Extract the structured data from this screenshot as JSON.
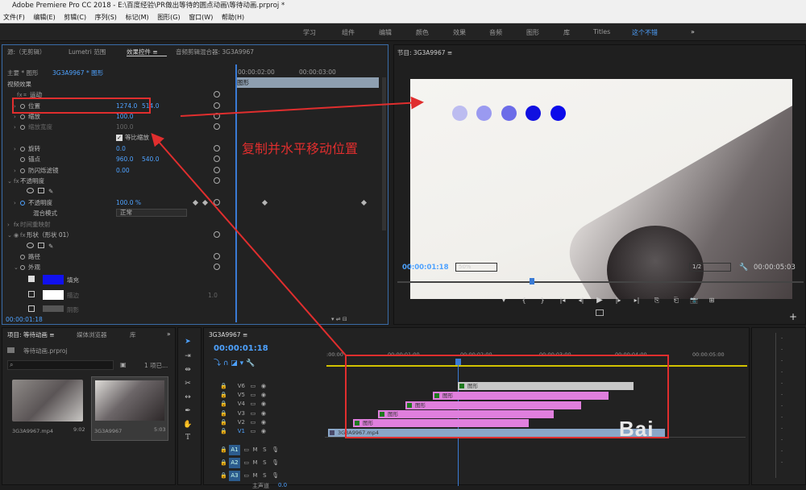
{
  "app": {
    "title": "Adobe Premiere Pro CC 2018 - E:\\百度经验\\PR做出等待的圆点动画\\等待动画.prproj *",
    "logo": "Pr"
  },
  "menu": [
    "文件(F)",
    "编辑(E)",
    "剪辑(C)",
    "序列(S)",
    "标记(M)",
    "图形(G)",
    "窗口(W)",
    "帮助(H)"
  ],
  "workspaces": [
    "学习",
    "组件",
    "编辑",
    "颜色",
    "效果",
    "音频",
    "图形",
    "库",
    "Titles",
    "这个不错",
    "»"
  ],
  "active_workspace_index": 9,
  "effect_panel": {
    "tabs": [
      "源:（无剪辑）",
      "Lumetri 范围",
      "效果控件 ≡",
      "音频剪辑混合器: 3G3A9967"
    ],
    "master": "主要 * 图形",
    "clip": "3G3A9967 * 图形",
    "time1": "00:00:02:00",
    "time2": "00:00:03:00",
    "track_label": "图形",
    "section_video": "视频效果",
    "motion": "运动",
    "position_label": "位置",
    "position_x": "1274.0",
    "position_y": "514.0",
    "scale_label": "缩放",
    "scale": "100.0",
    "scale_width_label": "缩放宽度",
    "scale_width": "100.0",
    "uniform_label": "等比缩放",
    "rotation_label": "旋转",
    "rotation": "0.0",
    "anchor_label": "锚点",
    "anchor_x": "960.0",
    "anchor_y": "540.0",
    "flicker_label": "防闪烁滤镜",
    "flicker": "0.00",
    "opacity_section": "不透明度",
    "opacity_label": "不透明度",
    "opacity": "100.0 %",
    "blend_label": "混合模式",
    "blend": "正常",
    "timeremap": "时间重映射",
    "shape": "形状（形状 01）",
    "path": "路径",
    "appearance": "外观",
    "fill": "填充",
    "stroke": "描边",
    "shadow": "阴影",
    "stroke_val": "1.0",
    "timecode": "00:00:01:18"
  },
  "annotation": {
    "text": "复制并水平移动位置"
  },
  "program": {
    "title": "节目: 3G3A9967 ≡",
    "timecode": "00:00:01:18",
    "zoom": "50%",
    "quality": "1/2",
    "duration": "00:00:05:03",
    "controls": [
      "▾",
      "{",
      "}",
      "|◂",
      "◂|",
      "▶",
      "|▸",
      "▸|",
      "⎘",
      "⎗",
      "📷",
      "⊞"
    ],
    "plus": "+",
    "dots": [
      "#bcbcf0",
      "#9a9af0",
      "#6c6ce8",
      "#1010e0",
      "#0b0bea"
    ]
  },
  "project": {
    "tabs": [
      "项目: 等待动画 ≡",
      "媒体浏览器",
      "库",
      "»"
    ],
    "file": "等待动画.prproj",
    "count": "1 项已...",
    "items": [
      {
        "name": "3G3A9967.mp4",
        "dur": "9:02"
      },
      {
        "name": "3G3A9967",
        "dur": "5:03"
      }
    ]
  },
  "timeline": {
    "tab": "3G3A9967 ≡",
    "timecode": "00:00:01:18",
    "ruler": [
      ":00:00",
      "00:00:01:00",
      "00:00:02:00",
      "00:00:03:00",
      "00:00:04:00",
      "00:00:05:00"
    ],
    "tracks_v": [
      "V6",
      "V5",
      "V4",
      "V3",
      "V2",
      "V1"
    ],
    "tracks_a": [
      "A1",
      "A2",
      "A3"
    ],
    "master": "主声道",
    "master_val": "0.0",
    "clip_label": "图形",
    "video_clip": "3G3A9967.mp4"
  },
  "watermark": "Bai"
}
